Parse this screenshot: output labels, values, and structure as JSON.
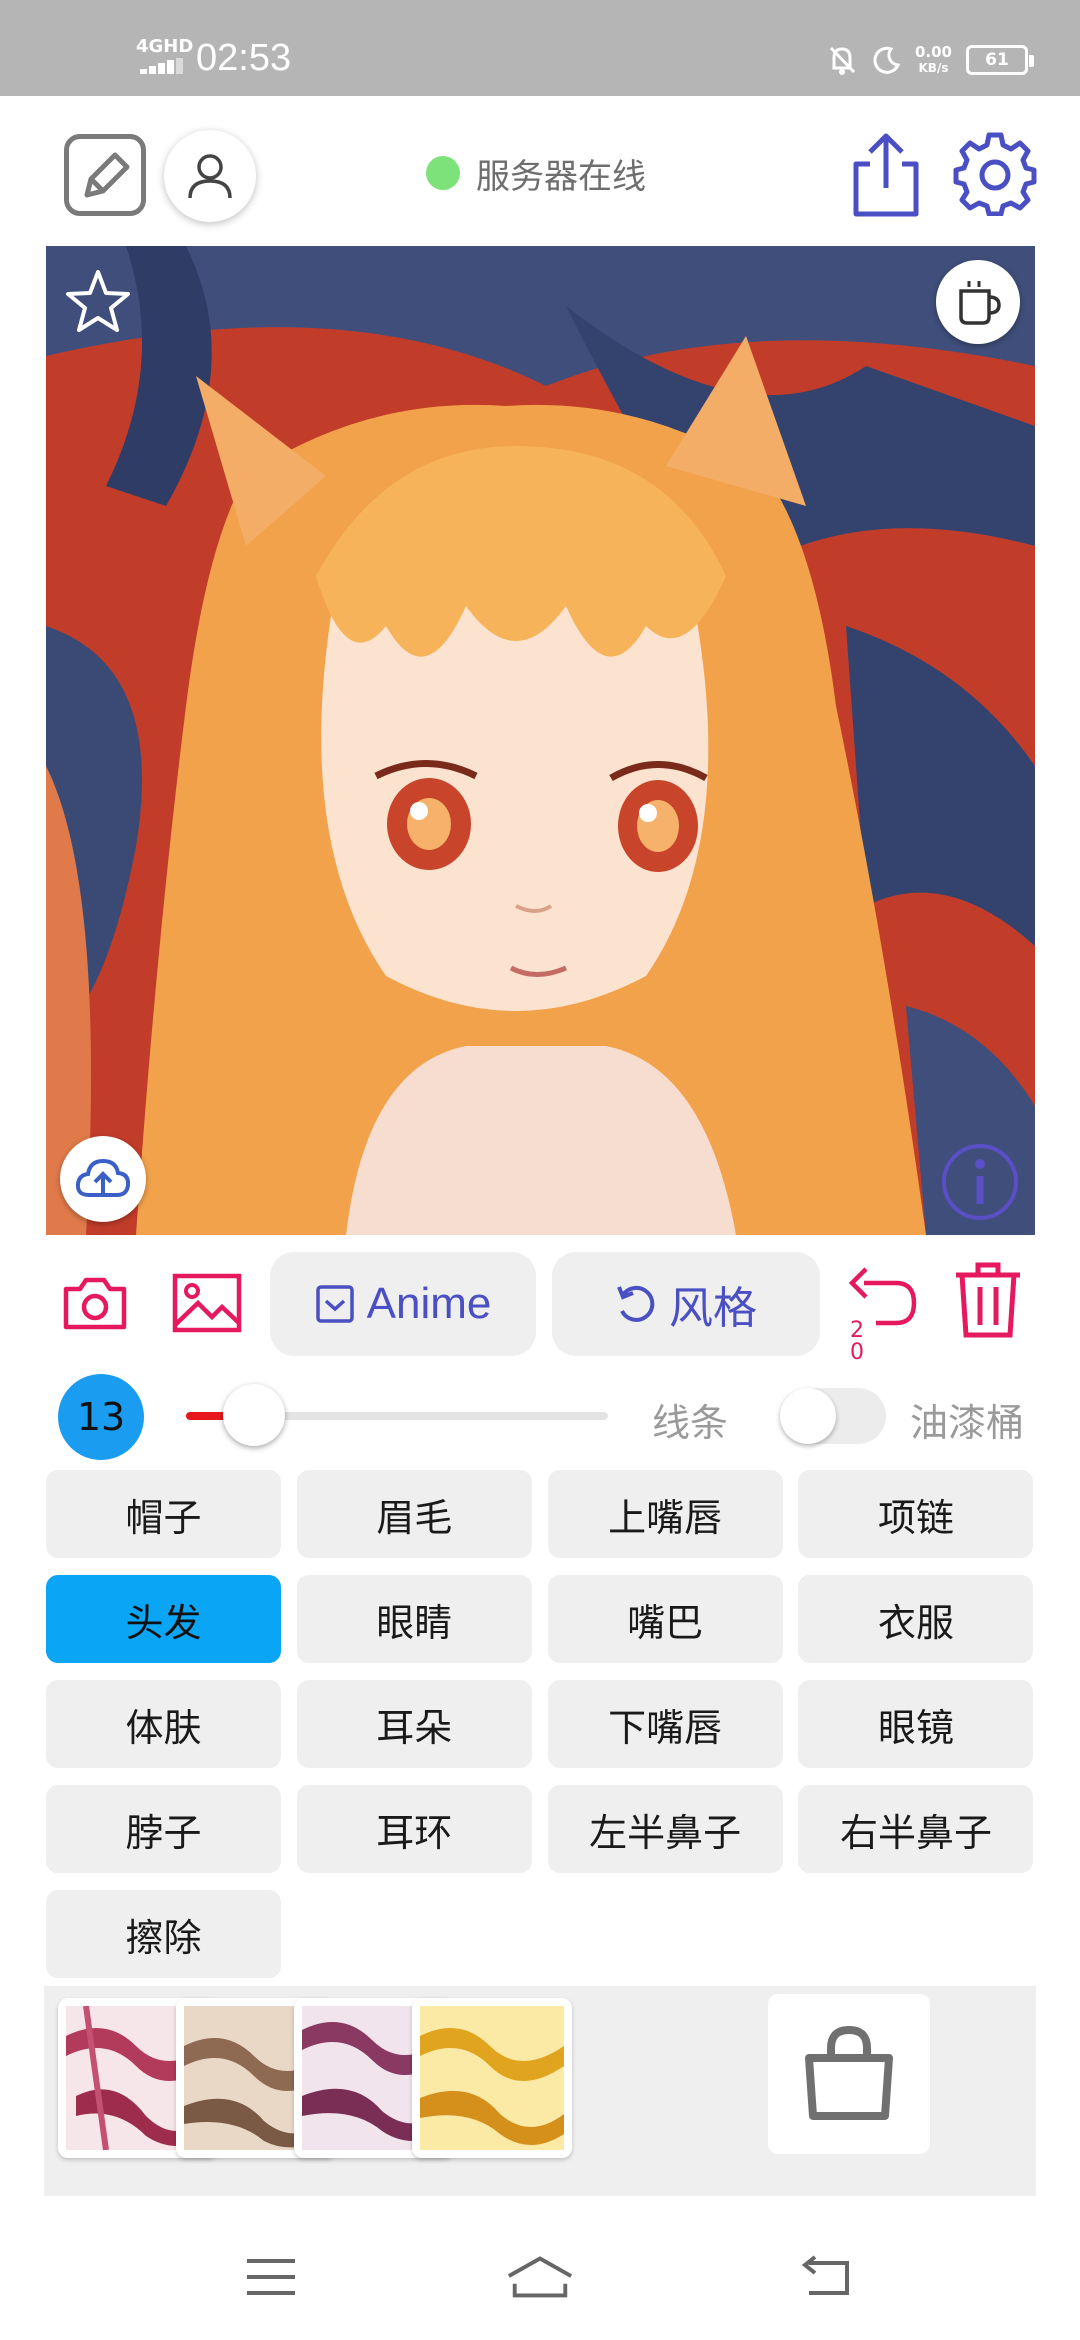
{
  "status_bar": {
    "network": "4GHD",
    "time": "02:53",
    "speed_value": "0.00",
    "speed_unit": "KB/s",
    "battery": "61"
  },
  "header": {
    "server_status": "服务器在线",
    "status_color": "#7ee27a"
  },
  "toolbar": {
    "anime_label": "Anime",
    "style_label": "风格",
    "undo_count": "2\n0",
    "accent_color": "#e6195f",
    "pill_text_color": "#4a4fc4"
  },
  "brush": {
    "size": "13",
    "slider_level": 0.16,
    "line_label": "线条",
    "bucket_label": "油漆桶",
    "bucket_enabled": false
  },
  "parts": [
    [
      "帽子",
      "眉毛",
      "上嘴唇",
      "项链"
    ],
    [
      "头发",
      "眼睛",
      "嘴巴",
      "衣服"
    ],
    [
      "体肤",
      "耳朵",
      "下嘴唇",
      "眼镜"
    ],
    [
      "脖子",
      "耳环",
      "左半鼻子",
      "右半鼻子"
    ],
    [
      "擦除"
    ]
  ],
  "selected_part": "头发",
  "icons": {
    "edit": "edit-square-icon",
    "user": "user-icon",
    "share": "share-icon",
    "settings": "gear-icon",
    "favorite": "star-icon",
    "coffee": "coffee-cup-icon",
    "upload": "cloud-upload-icon",
    "info": "info-icon",
    "camera": "camera-icon",
    "gallery": "image-icon",
    "undo": "undo-icon",
    "delete": "trash-icon",
    "shop": "shopping-bag-icon",
    "menu": "menu-icon",
    "home": "home-icon",
    "back": "back-icon"
  }
}
